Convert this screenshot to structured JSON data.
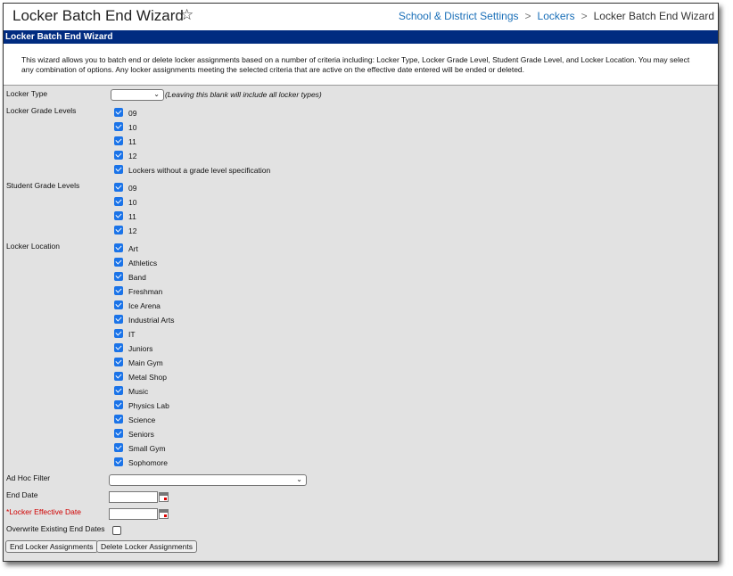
{
  "header": {
    "title": "Locker Batch End Wizard",
    "breadcrumb": [
      "School & District Settings",
      "Lockers",
      "Locker Batch End Wizard"
    ]
  },
  "bar_title": "Locker Batch End Wizard",
  "intro": "This wizard allows you to batch end or delete locker assignments based on a number of criteria including: Locker Type, Locker Grade Level, Student Grade Level, and Locker Location. You may select any combination of options. Any locker assignments meeting the selected criteria that are active on the effective date entered will be ended or deleted.",
  "form": {
    "locker_type_label": "Locker Type",
    "locker_type_value": "",
    "locker_type_hint": "(Leaving this blank will include all locker types)",
    "locker_grade_label": "Locker Grade Levels",
    "locker_grades": [
      "09",
      "10",
      "11",
      "12",
      "Lockers without a grade level specification"
    ],
    "student_grade_label": "Student Grade Levels",
    "student_grades": [
      "09",
      "10",
      "11",
      "12"
    ],
    "location_label": "Locker Location",
    "locations": [
      "Art",
      "Athletics",
      "Band",
      "Freshman",
      "Ice Arena",
      "Industrial Arts",
      "IT",
      "Juniors",
      "Main Gym",
      "Metal Shop",
      "Music",
      "Physics Lab",
      "Science",
      "Seniors",
      "Small Gym",
      "Sophomore"
    ],
    "adhoc_label": "Ad Hoc Filter",
    "adhoc_value": "",
    "end_date_label": "End Date",
    "end_date_value": "",
    "required_mark": "*",
    "effective_date_label": "Locker Effective Date",
    "effective_date_value": "",
    "overwrite_label": "Overwrite Existing End Dates"
  },
  "buttons": {
    "end": "End Locker Assignments",
    "delete": "Delete Locker Assignments"
  },
  "colors": {
    "bar": "#002b80",
    "link": "#1a6fb8",
    "checkbox": "#1a73e8",
    "required": "#d00000"
  }
}
